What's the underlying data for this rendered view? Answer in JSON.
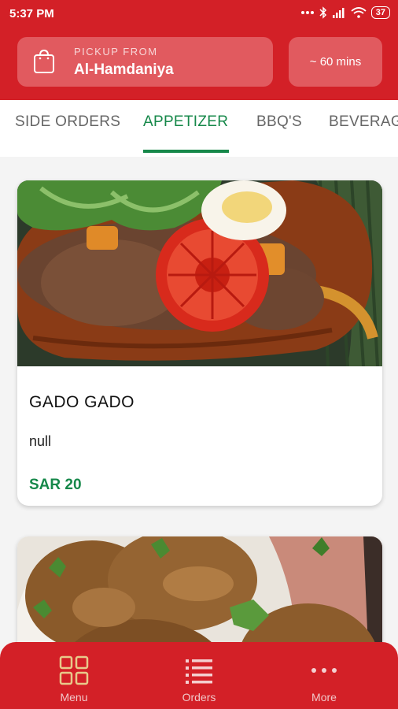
{
  "status_bar": {
    "time": "5:37 PM",
    "battery": "37",
    "icons": [
      "more-dots-icon",
      "bluetooth-icon",
      "signal-icon",
      "wifi-icon",
      "battery-icon"
    ]
  },
  "header": {
    "pickup_label": "PICKUP FROM",
    "pickup_location": "Al-Hamdaniya",
    "estimated_time": "~ 60 mins",
    "icon": "shopping-bag-icon"
  },
  "tabs": [
    {
      "label": "SIDE ORDERS",
      "active": false
    },
    {
      "label": "APPETIZER",
      "active": true
    },
    {
      "label": "BBQ'S",
      "active": false
    },
    {
      "label": "BEVERAGES",
      "active": false
    }
  ],
  "menu_items": [
    {
      "name": "GADO GADO",
      "description": "null",
      "price": "SAR 20"
    },
    {
      "name": "",
      "description": "",
      "price": ""
    }
  ],
  "bottom_nav": [
    {
      "label": "Menu",
      "icon": "grid-icon",
      "active": true
    },
    {
      "label": "Orders",
      "icon": "list-icon",
      "active": false
    },
    {
      "label": "More",
      "icon": "more-dots-icon",
      "active": false
    }
  ],
  "colors": {
    "brand_red": "#d32027",
    "accent_green": "#16884a",
    "card_overlay": "#e15a5f",
    "nav_active_icon": "#e8c98a"
  }
}
